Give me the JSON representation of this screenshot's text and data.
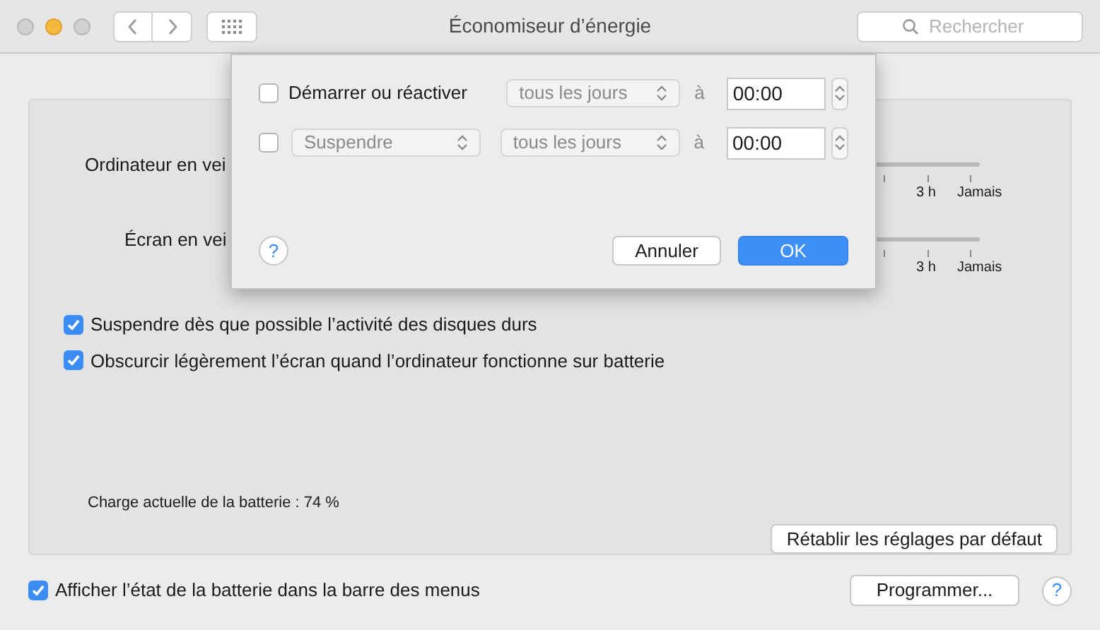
{
  "window": {
    "title": "Économiseur d’énergie",
    "search": {
      "placeholder": "Rechercher"
    }
  },
  "panel": {
    "sliders": [
      {
        "label": "Ordinateur en vei",
        "ticks": [
          "3 h",
          "Jamais"
        ]
      },
      {
        "label": "Écran en vei",
        "ticks": [
          "3 h",
          "Jamais"
        ]
      }
    ],
    "options": [
      {
        "label": "Suspendre dès que possible l’activité des disques durs",
        "checked": true
      },
      {
        "label": "Obscurcir légèrement l’écran quand l’ordinateur fonctionne sur batterie",
        "checked": true
      }
    ],
    "battery": "Charge actuelle de la batterie : 74 %",
    "reset": "Rétablir les réglages par défaut"
  },
  "footer": {
    "option": {
      "label": "Afficher l’état de la batterie dans la barre des menus",
      "checked": true
    },
    "schedule": "Programmer...",
    "help": "?"
  },
  "sheet": {
    "rows": [
      {
        "kind": "label",
        "checked": false,
        "action": "Démarrer ou réactiver",
        "frequency": "tous les jours",
        "at": "à",
        "time": "00:00"
      },
      {
        "kind": "popup",
        "checked": false,
        "action": "Suspendre",
        "frequency": "tous les jours",
        "at": "à",
        "time": "00:00"
      }
    ],
    "help": "?",
    "cancel": "Annuler",
    "ok": "OK"
  }
}
